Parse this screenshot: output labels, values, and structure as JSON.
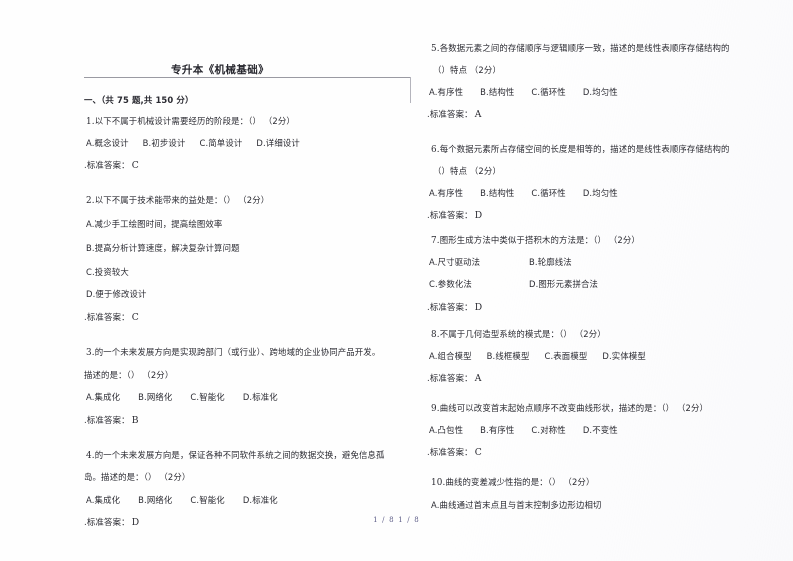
{
  "document": {
    "title": "专升本《机械基础》",
    "footer": "1 / 8 1 / 8"
  },
  "section": {
    "heading": "一、（共 75 题,共 150 分）"
  },
  "columns": {
    "left": [
      {
        "id": "q1",
        "number": "1.",
        "stem": "以下不属于机械设计需要经历的阶段是：（）  （2分）",
        "options": [
          "A.概念设计",
          "B.初步设计",
          "C.简单设计",
          "D.详细设计"
        ],
        "options_layout": "inline",
        "answer_label": ".标准答案：",
        "answer": "C"
      },
      {
        "id": "q2",
        "number": "2.",
        "stem": "以下不属于技术能带来的益处是：（）  （2分）",
        "options": [
          "A.减少手工绘图时间，提高绘图效率",
          "B.提高分析计算速度，解决复杂计算问题",
          "C.投资较大",
          "D.便于修改设计"
        ],
        "options_layout": "stacked",
        "answer_label": ".标准答案：",
        "answer": "C"
      },
      {
        "id": "q3",
        "number": "3.",
        "stem": "的一个未来发展方向是实现跨部门（或行业）、跨地域的企业协同产品开发。",
        "stem_cont": "描述的是：（）  （2分）",
        "options": [
          "A.集成化",
          "B.网络化",
          "C.智能化",
          "D.标准化"
        ],
        "options_layout": "inline",
        "answer_label": ".标准答案：",
        "answer": "B"
      },
      {
        "id": "q4",
        "number": "4.",
        "stem": "的一个未来发展方向是，保证各种不同软件系统之间的数据交换，避免信息孤",
        "stem_cont": "岛。描述的是：（）  （2分）",
        "options": [
          "A.集成化",
          "B.网络化",
          "C.智能化",
          "D.标准化"
        ],
        "options_layout": "inline",
        "answer_label": ".标准答案：",
        "answer": "D"
      }
    ],
    "right": [
      {
        "id": "q5",
        "number": "5.",
        "stem": "各数据元素之间的存储顺序与逻辑顺序一致，描述的是线性表顺序存储结构的",
        "stem_cont": "（）特点  （2分）",
        "options": [
          "A.有序性",
          "B.结构性",
          "C.循环性",
          "D.均匀性"
        ],
        "options_layout": "inline",
        "answer_label": ".标准答案：",
        "answer": "A"
      },
      {
        "id": "q6",
        "number": "6.",
        "stem": "每个数据元素所占存储空间的长度是相等的，描述的是线性表顺序存储结构的",
        "stem_cont": "（）特点  （2分）",
        "options": [
          "A.有序性",
          "B.结构性",
          "C.循环性",
          "D.均匀性"
        ],
        "options_layout": "inline",
        "answer_label": ".标准答案：",
        "answer": "D"
      },
      {
        "id": "q7",
        "number": "7.",
        "stem": "图形生成方法中类似于搭积木的方法是：（）  （2分）",
        "options": [
          "A.尺寸驱动法",
          "B.轮廓线法",
          "C.参数化法",
          "D.图形元素拼合法"
        ],
        "options_layout": "grid2",
        "answer_label": ".标准答案：",
        "answer": "D"
      },
      {
        "id": "q8",
        "number": "8.",
        "stem": "不属于几何造型系统的模式是：（）  （2分）",
        "options": [
          "A.组合模型",
          "B.线框模型",
          "C.表面模型",
          "D.实体模型"
        ],
        "options_layout": "inline",
        "answer_label": ".标准答案：",
        "answer": "A"
      },
      {
        "id": "q9",
        "number": "9.",
        "stem": "曲线可以改变首末起始点顺序不改变曲线形状，描述的是：（）  （2分）",
        "options": [
          "A.凸包性",
          "B.有序性",
          "C.对称性",
          "D.不变性"
        ],
        "options_layout": "inline",
        "answer_label": ".标准答案：",
        "answer": "C"
      },
      {
        "id": "q10",
        "number": "10.",
        "stem": "曲线的变差减少性指的是：（）  （2分）",
        "options": [
          "A.曲线通过首末点且与首末控制多边形边相切"
        ],
        "options_layout": "stacked",
        "answer_label": "",
        "answer": ""
      }
    ]
  }
}
